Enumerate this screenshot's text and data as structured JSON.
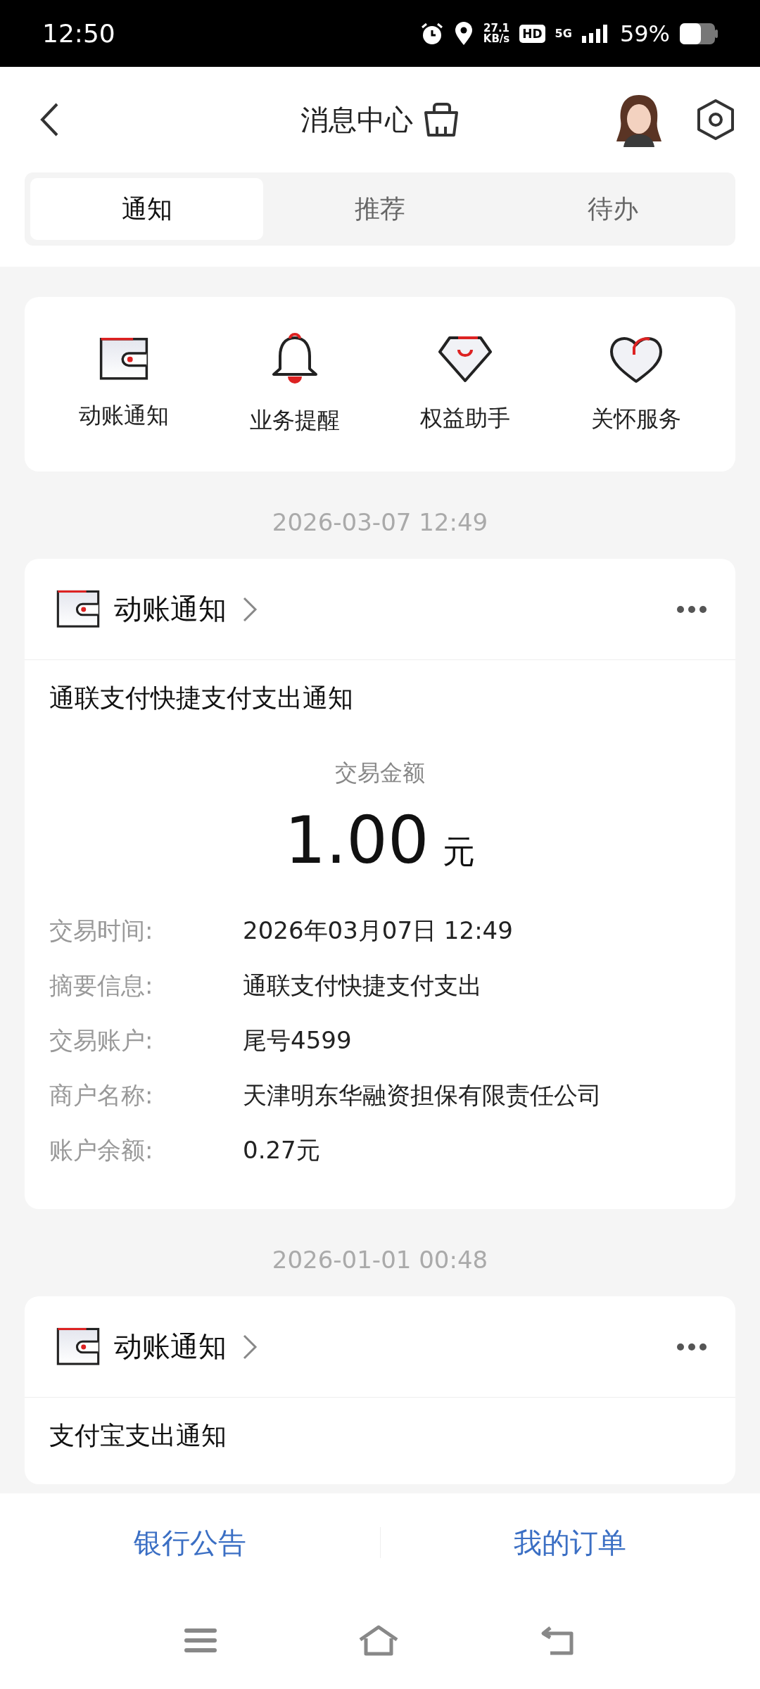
{
  "status_bar": {
    "time": "12:50",
    "speed": "27.1",
    "speed_unit": "KB/s",
    "hd": "HD",
    "network": "5G",
    "battery": "59%"
  },
  "header": {
    "title": "消息中心"
  },
  "tabs": [
    {
      "label": "通知",
      "selected": true
    },
    {
      "label": "推荐",
      "selected": false
    },
    {
      "label": "待办",
      "selected": false
    }
  ],
  "quick_links": [
    {
      "kind": "wallet",
      "label": "动账通知"
    },
    {
      "kind": "bell",
      "label": "业务提醒"
    },
    {
      "kind": "diamond",
      "label": "权益助手"
    },
    {
      "kind": "heart",
      "label": "关怀服务"
    }
  ],
  "notices": [
    {
      "date": "2026-03-07 12:49",
      "category": "动账通知",
      "title": "通联支付快捷支付支出通知",
      "amount_label": "交易金额",
      "amount": "1.00",
      "unit": "元",
      "fields": [
        {
          "label": "交易时间:",
          "value": "2026年03月07日 12:49"
        },
        {
          "label": "摘要信息:",
          "value": "通联支付快捷支付支出"
        },
        {
          "label": "交易账户:",
          "value": "尾号4599"
        },
        {
          "label": "商户名称:",
          "value": "天津明东华融资担保有限责任公司"
        },
        {
          "label": "账户余额:",
          "value": "0.27元"
        }
      ]
    },
    {
      "date": "2026-01-01 00:48",
      "category": "动账通知",
      "title": "支付宝支出通知"
    }
  ],
  "footer": [
    "银行公告",
    "我的订单"
  ]
}
